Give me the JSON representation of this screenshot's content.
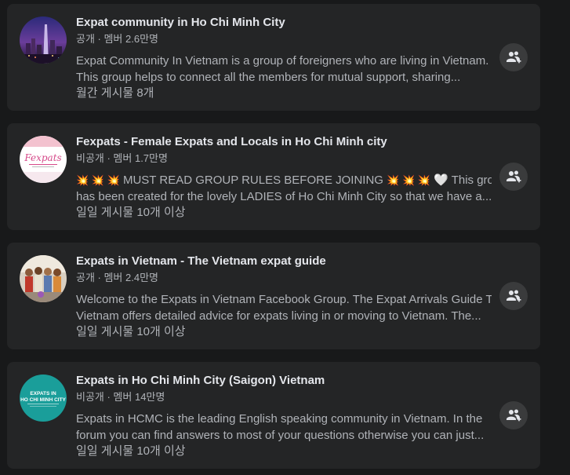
{
  "groups": [
    {
      "title": "Expat community in Ho Chi Minh City",
      "meta": "공개 · 멤버 2.6만명",
      "desc_line1": "Expat Community In Vietnam is a group of foreigners who are living in Vietnam.",
      "desc_line2": "This group helps to connect all the members for mutual support, sharing...",
      "activity": "월간 게시물 8개",
      "avatar_icon": "city-skyline-avatar"
    },
    {
      "title": "Fexpats - Female Expats and Locals in Ho Chi Minh city",
      "meta": "비공개 · 멤버 1.7만명",
      "desc_prefix": "💥 💥 💥",
      "desc_main": " MUST READ GROUP RULES BEFORE JOINING ",
      "desc_suffix": "💥 💥 💥",
      "desc_heart": "🤍",
      "desc_tail": " This group",
      "desc_line2": "has been created for the lovely LADIES of Ho Chi Minh City so that we have a...",
      "activity": "일일 게시물 10개 이상",
      "avatar_text": "Fexpats",
      "avatar_icon": "fexpats-logo-avatar"
    },
    {
      "title": "Expats in Vietnam - The Vietnam expat guide",
      "meta": "공개 · 멤버 2.4만명",
      "desc_line1": "Welcome to the Expats in Vietnam Facebook Group. The Expat Arrivals Guide To",
      "desc_line2": "Vietnam offers detailed advice for expats living in or moving to Vietnam. The...",
      "activity": "일일 게시물 10개 이상",
      "avatar_icon": "group-photo-avatar"
    },
    {
      "title": "Expats in Ho Chi Minh City (Saigon) Vietnam",
      "meta": "비공개 · 멤버 14만명",
      "desc_line1": "Expats in HCMC is the leading English speaking community in Vietnam. In the",
      "desc_line2": "forum you can find answers to most of your questions otherwise you can just...",
      "activity": "일일 게시물 10개 이상",
      "avatar_text_top": "EXPATS IN",
      "avatar_text_bottom": "HO CHI MINH CITY",
      "avatar_icon": "expats-hcmc-logo-avatar"
    }
  ],
  "join_icon": "join-group-icon",
  "colors": {
    "background": "#18191a",
    "card": "#242526",
    "button": "#3a3b3c",
    "primary_text": "#e4e6eb",
    "secondary_text": "#b0b3b8",
    "teal_logo": "#1a9e9a"
  }
}
